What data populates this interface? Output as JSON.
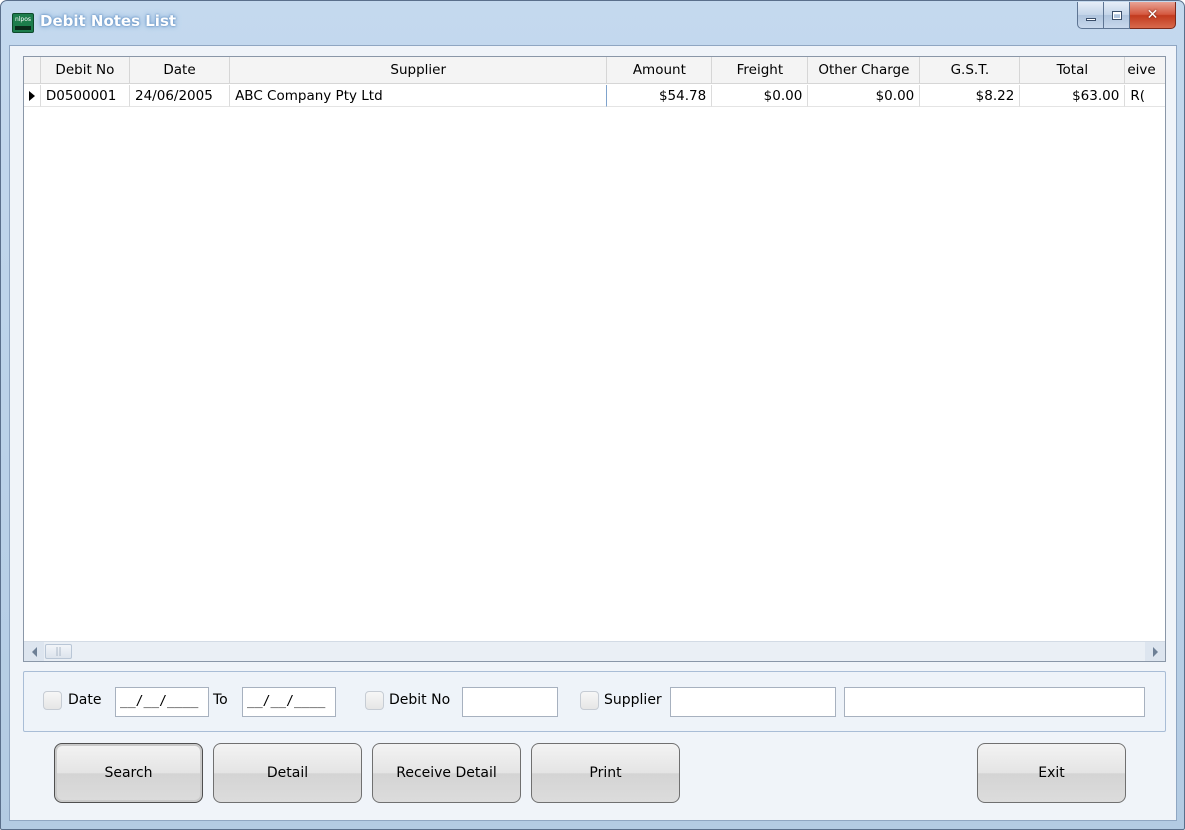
{
  "window": {
    "title": "Debit Notes List",
    "app_icon_text": "nlpos",
    "close_glyph": "✕"
  },
  "grid": {
    "columns": [
      "Debit No",
      "Date",
      "Supplier",
      "Amount",
      "Freight",
      "Other Charge",
      "G.S.T.",
      "Total",
      "eive"
    ],
    "rows": [
      {
        "debit_no": "D0500001",
        "date": "24/06/2005",
        "supplier": "ABC Company Pty Ltd",
        "amount": "$54.78",
        "freight": "$0.00",
        "other_charge": "$0.00",
        "gst": "$8.22",
        "total": "$63.00",
        "received": "R("
      }
    ]
  },
  "filter": {
    "date_label": "Date",
    "date_from": "__/__/____",
    "to_label": "To",
    "date_to": "__/__/____",
    "debit_no_label": "Debit No",
    "debit_no_value": "",
    "supplier_label": "Supplier",
    "supplier_code": "",
    "supplier_name": ""
  },
  "buttons": {
    "search": "Search",
    "detail": "Detail",
    "receive_detail": "Receive Detail",
    "print": "Print",
    "exit": "Exit"
  },
  "icons": {
    "app": "app-logo-icon",
    "minimize": "minimize-icon",
    "maximize": "maximize-icon",
    "close": "close-icon",
    "row_indicator": "row-pointer-icon",
    "scroll_left": "scroll-left-icon",
    "scroll_right": "scroll-right-icon"
  },
  "colors": {
    "title_bar": "#b3cbe3",
    "close_button": "#c23a1e",
    "client_background": "#f0f4f9",
    "grid_header": "#f4f4f4"
  }
}
